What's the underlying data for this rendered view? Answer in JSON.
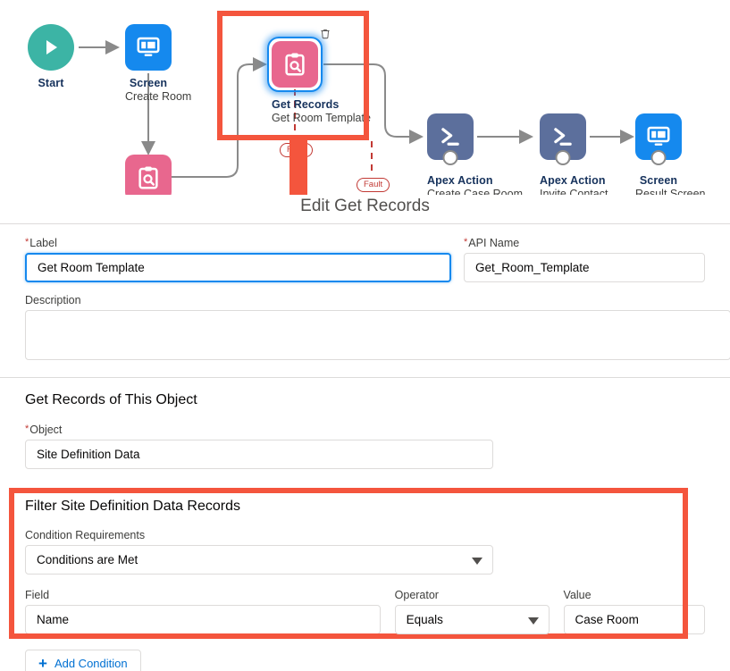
{
  "flow": {
    "nodes": [
      {
        "id": "start",
        "title": "Start",
        "subtitle": "",
        "icon": "play-icon",
        "color": "#3CB4A5"
      },
      {
        "id": "screen1",
        "title": "Screen",
        "subtitle": "Create Room",
        "icon": "screen-icon",
        "color": "#1589EE"
      },
      {
        "id": "getrecords1",
        "title": "",
        "subtitle": "",
        "icon": "get-records-icon",
        "color": "#E8678E"
      },
      {
        "id": "getrecords2",
        "title": "Get Records",
        "subtitle": "Get Room Template",
        "icon": "get-records-icon",
        "color": "#E8678E"
      },
      {
        "id": "apex1",
        "title": "Apex Action",
        "subtitle": "Create Case Room",
        "icon": "apex-action-icon",
        "color": "#5C6F9C"
      },
      {
        "id": "apex2",
        "title": "Apex Action",
        "subtitle": "Invite Contact",
        "icon": "apex-action-icon",
        "color": "#5C6F9C"
      },
      {
        "id": "screen2",
        "title": "Screen",
        "subtitle": "Result Screen",
        "icon": "screen-icon",
        "color": "#1589EE"
      }
    ],
    "fault_label_1": "Fault",
    "fault_label_2": "Fault",
    "delete_icon": "trash-icon",
    "highlight_color": "#F4553D"
  },
  "modal": {
    "title": "Edit Get Records",
    "label_field": {
      "label": "Label",
      "required": true,
      "value": "Get Room Template",
      "placeholder": ""
    },
    "api_name_field": {
      "label": "API Name",
      "required": true,
      "value": "Get_Room_Template",
      "placeholder": ""
    },
    "description_field": {
      "label": "Description",
      "value": "",
      "placeholder": ""
    },
    "object_section": {
      "heading": "Get Records of This Object",
      "object_label": "Object",
      "object_required": true,
      "object_value": "Site Definition Data",
      "object_placeholder": ""
    },
    "filter_section": {
      "heading": "Filter Site Definition Data Records",
      "condition_requirements_label": "Condition Requirements",
      "condition_requirements_value": "Conditions are Met",
      "field_label": "Field",
      "field_value": "Name",
      "operator_label": "Operator",
      "operator_value": "Equals",
      "value_label": "Value",
      "value_value": "Case Room"
    },
    "add_condition_button": "Add Condition"
  }
}
